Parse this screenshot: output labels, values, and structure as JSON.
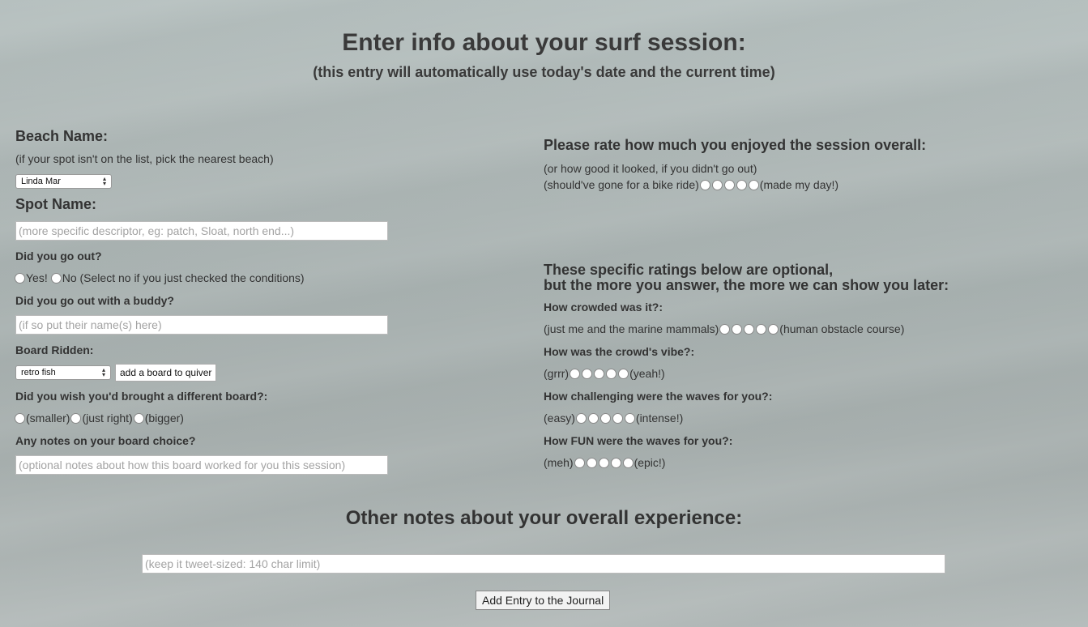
{
  "header": {
    "title": "Enter info about your surf session:",
    "subtitle": "(this entry will automatically use today's date and the current time)"
  },
  "left": {
    "beach_label": "Beach Name:",
    "beach_hint": "(if your spot isn't on the list, pick the nearest beach)",
    "beach_selected": "Linda Mar",
    "spot_label": "Spot Name:",
    "spot_placeholder": "(more specific descriptor, eg: patch, Sloat, north end...)",
    "went_out_label": "Did you go out?",
    "went_out_yes": "Yes!",
    "went_out_no": "No (Select no if you just checked the conditions)",
    "buddy_label": "Did you go out with a buddy?",
    "buddy_placeholder": "(if so put their name(s) here)",
    "board_label": "Board Ridden:",
    "board_selected": "retro fish",
    "add_board_button": "add a board to quiver",
    "different_board_label": "Did you wish you'd brought a different board?:",
    "different_board_options": [
      "(smaller)",
      "(just right)",
      "(bigger)"
    ],
    "board_notes_label": "Any notes on your board choice?",
    "board_notes_placeholder": "(optional notes about how this board worked for you this session)"
  },
  "right": {
    "overall_label": "Please rate how much you enjoyed the session overall:",
    "overall_hint": "(or how good it looked, if you didn't go out)",
    "overall_low": "(should've gone for a bike ride)",
    "overall_high": "(made my day!)",
    "optional_line1": "These specific ratings below are optional,",
    "optional_line2": "but the more you answer, the more we can show you later:",
    "ratings": [
      {
        "question": "How crowded was it?:",
        "low": "(just me and the marine mammals)",
        "high": "(human obstacle course)"
      },
      {
        "question": "How was the crowd's vibe?:",
        "low": "(grrr)",
        "high": "(yeah!)"
      },
      {
        "question": "How challenging were the waves for you?:",
        "low": "(easy)",
        "high": "(intense!)"
      },
      {
        "question": "How FUN were the waves for you?:",
        "low": "(meh)",
        "high": "(epic!)"
      }
    ]
  },
  "footer": {
    "notes_label": "Other notes about your overall experience:",
    "notes_placeholder": "(keep it tweet-sized: 140 char limit)",
    "submit_button": "Add Entry to the Journal"
  }
}
